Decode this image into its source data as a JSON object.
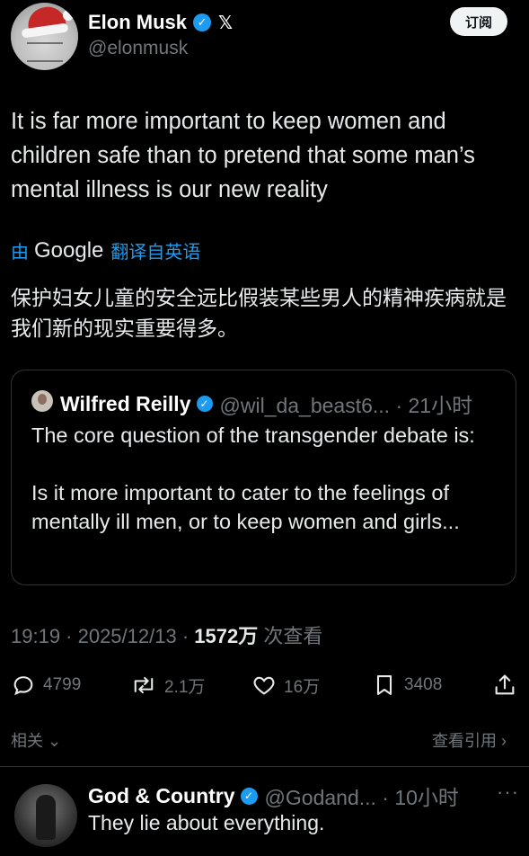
{
  "author": {
    "name": "Elon Musk",
    "handle": "@elonmusk",
    "avatar_icon": "santa-hat-avatar",
    "x_icon_glyph": "𝕏"
  },
  "follow_button": "订阅",
  "tweet_text": "It is far more important to keep women and children safe than to pretend that some man’s mental illness is our new reality",
  "translation_bar": {
    "prefix": "由",
    "provider": "Google",
    "suffix": "翻译自英语"
  },
  "translation_text": "保护妇女儿童的安全远比假装某些男人的精神疾病就是我们新的现实重要得多。",
  "quote": {
    "name": "Wilfred Reilly",
    "handle": "@wil_da_beast6... · 21小时",
    "text_line1": "The core question of the transgender debate is:",
    "text_line2": "Is it more important to cater to the feelings of mentally ill men, or to keep women and girls..."
  },
  "meta": {
    "time_date": "19:19 · 2025/12/13 · ",
    "views_count": "1572万",
    "views_label": " 次查看"
  },
  "actions": {
    "replies": "4799",
    "retweets": "2.1万",
    "likes": "16万",
    "bookmarks": "3408"
  },
  "related": {
    "left_label": "相关",
    "right_label": "查看引用"
  },
  "reply": {
    "name": "God & Country",
    "handle": "@Godand... · 10小时",
    "more_glyph": "···",
    "text": "They lie about everything."
  },
  "colors": {
    "background": "#000000",
    "text": "#e7e9ea",
    "muted": "#71767b",
    "accent": "#1d9bf0",
    "border": "#2f3336"
  }
}
